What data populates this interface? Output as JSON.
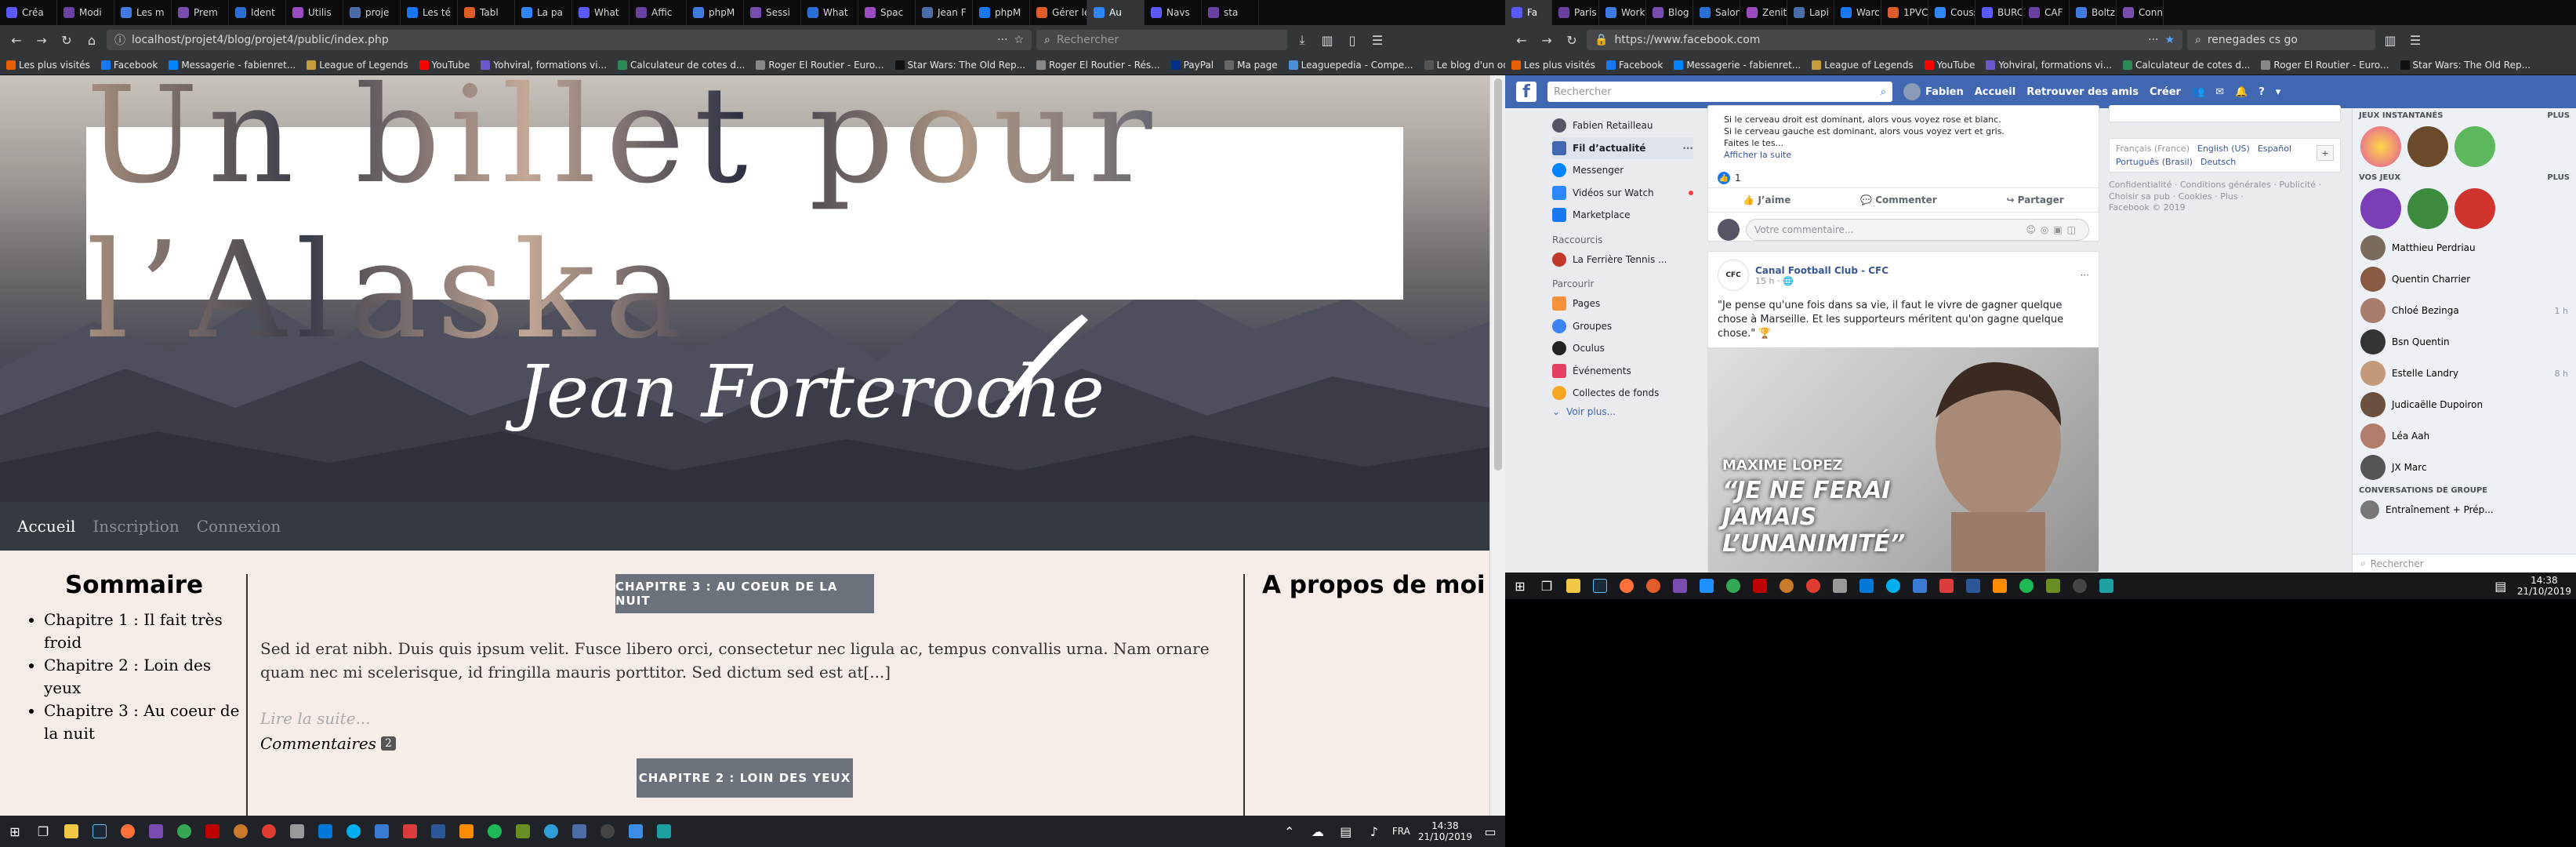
{
  "left": {
    "tabs": [
      "Créa",
      "Modi",
      "Les m",
      "Prem",
      "Ident",
      "Utilis",
      "proje",
      "Les té",
      "Tabl",
      "La pa",
      "What",
      "Affic",
      "phpM",
      "Sessi",
      "What",
      "Spac",
      "Jean F",
      "phpM",
      "Gérer les ...",
      "Au",
      "Navs",
      "sta"
    ],
    "active_tab_index": 19,
    "url": "localhost/projet4/blog/projet4/public/index.php",
    "search_placeholder": "Rechercher",
    "bookmarks": [
      "Les plus visités",
      "Facebook",
      "Messagerie - fabienret...",
      "League of Legends",
      "YouTube",
      "Yohviral, formations vi...",
      "Calculateur de cotes d...",
      "Roger El Routier - Euro...",
      "Star Wars: The Old Rep...",
      "Roger El Routier - Rés...",
      "PayPal",
      "Ma page",
      "Leaguepedia - Compe...",
      "Le blog d'un odieux c..."
    ],
    "blog": {
      "title": "Un billet pour l’Alaska",
      "author": "Jean Forteroche",
      "nav": [
        "Accueil",
        "Inscription",
        "Connexion"
      ],
      "sommaire_title": "Sommaire",
      "chapters": [
        "Chapitre 1 : Il fait très froid",
        "Chapitre 2 : Loin des yeux",
        "Chapitre 3 : Au coeur de la nuit"
      ],
      "post_button": "CHAPITRE 3 : AU COEUR DE LA NUIT",
      "excerpt": "Sed id erat nibh. Duis quis ipsum velit. Fusce libero orci, consectetur nec ligula ac, tempus convallis urna. Nam ornare quam nec mi scelerisque, id fringilla mauris porttitor. Sed dictum sed est at[...]",
      "read_more": "Lire la suite...",
      "comments_label": "Commentaires",
      "comments_count": "2",
      "next_button": "CHAPITRE 2 : LOIN DES YEUX",
      "about_title": "A propos de moi"
    },
    "taskbar": {
      "lang": "FRA",
      "time": "14:38",
      "date": "21/10/2019"
    }
  },
  "right": {
    "tabs": [
      "Fa",
      "Paris",
      "Work",
      "Blog",
      "Salon",
      "Zenit",
      "Lapi",
      "Warc",
      "1PVC",
      "Couss",
      "BURC",
      "CAF",
      "Boltz",
      "Conn"
    ],
    "url": "https://www.facebook.com",
    "search_value": "renegades cs go",
    "bookmarks": [
      "Les plus visités",
      "Facebook",
      "Messagerie - fabienret...",
      "League of Legends",
      "YouTube",
      "Yohviral, formations vi...",
      "Calculateur de cotes d...",
      "Roger El Routier - Euro...",
      "Star Wars: The Old Rep..."
    ],
    "fb": {
      "search_placeholder": "Rechercher",
      "user": "Fabien",
      "nav": [
        "Accueil",
        "Retrouver des amis",
        "Créer"
      ],
      "side_user": "Fabien Retailleau",
      "side_items": [
        "Fil d’actualité",
        "Messenger",
        "Vidéos sur Watch",
        "Marketplace"
      ],
      "shortcuts_title": "Raccourcis",
      "shortcut": "La Ferrière Tennis ...",
      "explore_title": "Parcourir",
      "explore_items": [
        "Pages",
        "Groupes",
        "Oculus",
        "Événements",
        "Collectes de fonds"
      ],
      "see_more": "Voir plus...",
      "post1_lines": [
        "Si le cerveau droit est dominant, alors vous voyez rose et blanc.",
        "Si le cerveau gauche est dominant, alors vous voyez vert et gris.",
        "Faites le tes..."
      ],
      "post1_more": "Afficher la suite",
      "likes": "1",
      "actions": [
        "J’aime",
        "Commenter",
        "Partager"
      ],
      "comment_placeholder": "Votre commentaire...",
      "post2_author": "Canal Football Club - CFC",
      "post2_time": "15 h",
      "post2_text": "\"Je pense qu'une fois dans sa vie, il faut le vivre de gagner quelque chose à Marseille. Et les supporteurs méritent qu'on gagne quelque chose.\" 🏆",
      "post2_img_name": "MAXIME LOPEZ",
      "post2_img_quote": "“JE NE FERAI JAMAIS L’UNANIMITÉ”",
      "langs": [
        "Français (France)",
        "English (US)",
        "Español",
        "Português (Brasil)",
        "Deutsch"
      ],
      "footer": "Confidentialité · Conditions générales · Publicité · Choisir sa pub · Cookies · Plus ·",
      "copyright": "Facebook © 2019",
      "instant_games": "JEUX INSTANTANÉS",
      "your_games": "VOS JEUX",
      "plus": "PLUS",
      "contacts": [
        "Matthieu Perdriau",
        "Quentin Charrier",
        "Chloé Bezinga",
        "Bsn Quentin",
        "Estelle Landry",
        "Judicaëlle Dupoiron",
        "Léa Aah",
        "JX Marc"
      ],
      "contact_times": [
        "",
        "",
        "1 h",
        "",
        "8 h",
        "",
        "",
        ""
      ],
      "group_convs": "CONVERSATIONS DE GROUPE",
      "group_item": "Entraînement + Prép...",
      "chat_search": "Rechercher"
    },
    "taskbar": {
      "time": "14:38",
      "date": "21/10/2019"
    }
  }
}
